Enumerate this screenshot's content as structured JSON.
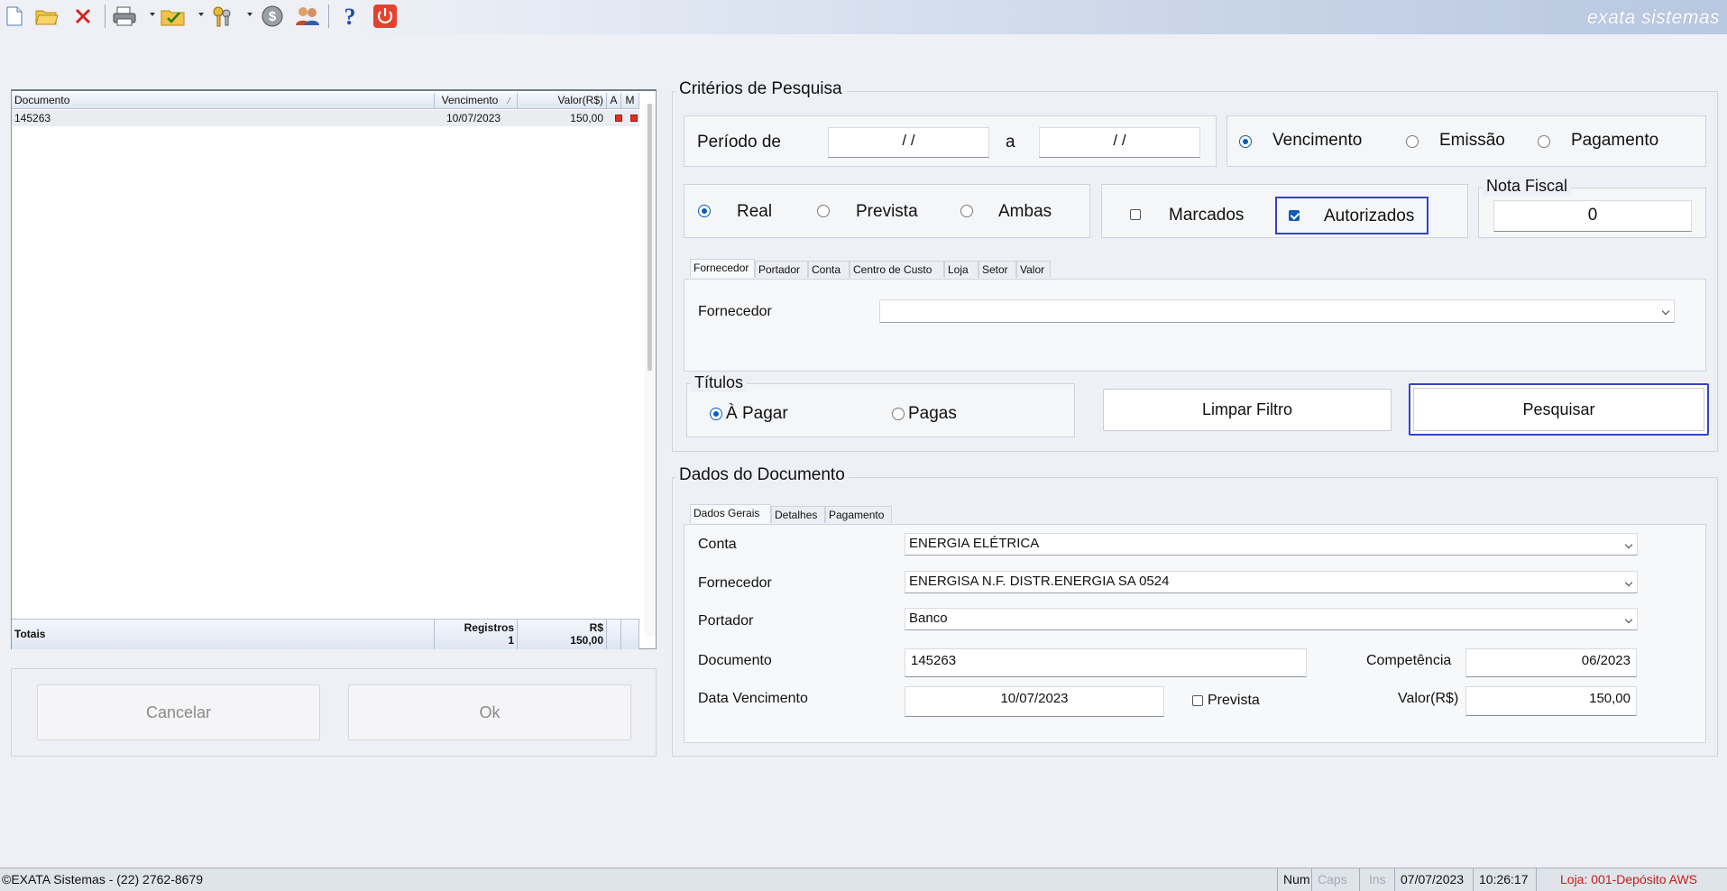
{
  "app": {
    "brand": "exata sistemas"
  },
  "toolbar": {
    "icons": [
      "new-document-icon",
      "open-folder-icon",
      "delete-icon",
      "print-icon",
      "folder-check-icon",
      "keys-icon",
      "money-icon",
      "users-icon",
      "help-icon",
      "power-icon"
    ]
  },
  "grid": {
    "columns": [
      "Documento",
      "Vencimento",
      "Valor(R$)",
      "A",
      "M"
    ],
    "rows": [
      {
        "documento": "145263",
        "vencimento": "10/07/2023",
        "valor": "150,00"
      }
    ],
    "totals": {
      "label": "Totais",
      "registros_label": "Registros",
      "registros": "1",
      "currency_label": "R$",
      "valor": "150,00"
    }
  },
  "bottom_buttons": {
    "cancel": "Cancelar",
    "ok": "Ok"
  },
  "criteria": {
    "legend": "Critérios de Pesquisa",
    "periodo_label": "Período de",
    "periodo_from": " /  /",
    "periodo_sep": "a",
    "periodo_to": " /  /",
    "date_type": {
      "options": [
        "Vencimento",
        "Emissão",
        "Pagamento"
      ],
      "selected": "Vencimento"
    },
    "kind": {
      "options": [
        "Real",
        "Prevista",
        "Ambas"
      ],
      "selected": "Real"
    },
    "marcados_label": "Marcados",
    "marcados_checked": false,
    "autorizados_label": "Autorizados",
    "autorizados_checked": true,
    "nota_fiscal_label": "Nota Fiscal",
    "nota_fiscal_value": "0",
    "tabs": [
      "Fornecedor",
      "Portador",
      "Conta",
      "Centro de Custo",
      "Loja",
      "Setor",
      "Valor"
    ],
    "active_tab": "Fornecedor",
    "fornecedor_label": "Fornecedor",
    "fornecedor_value": "",
    "titulos_legend": "Títulos",
    "titulos": {
      "options": [
        "À Pagar",
        "Pagas"
      ],
      "selected": "À Pagar"
    },
    "clear_button": "Limpar Filtro",
    "search_button": "Pesquisar"
  },
  "document": {
    "legend": "Dados do Documento",
    "tabs": [
      "Dados Gerais",
      "Detalhes",
      "Pagamento"
    ],
    "active_tab": "Dados Gerais",
    "conta_label": "Conta",
    "conta_value": "ENERGIA ELÉTRICA",
    "fornecedor_label": "Fornecedor",
    "fornecedor_value": "ENERGISA N.F. DISTR.ENERGIA SA 0524",
    "portador_label": "Portador",
    "portador_value": "Banco",
    "documento_label": "Documento",
    "documento_value": "145263",
    "competencia_label": "Competência",
    "competencia_value": "06/2023",
    "vencimento_label": "Data Vencimento",
    "vencimento_value": "10/07/2023",
    "prevista_label": "Prevista",
    "prevista_checked": false,
    "valor_label": "Valor(R$)",
    "valor_value": "150,00"
  },
  "statusbar": {
    "copyright": "©EXATA Sistemas - (22) 2762-8679",
    "num": "Num",
    "caps": "Caps",
    "ins": "Ins",
    "date": "07/07/2023",
    "time": "10:26:17",
    "loja": "Loja: 001-Depósito AWS",
    "loja_color": "#c0201a"
  }
}
